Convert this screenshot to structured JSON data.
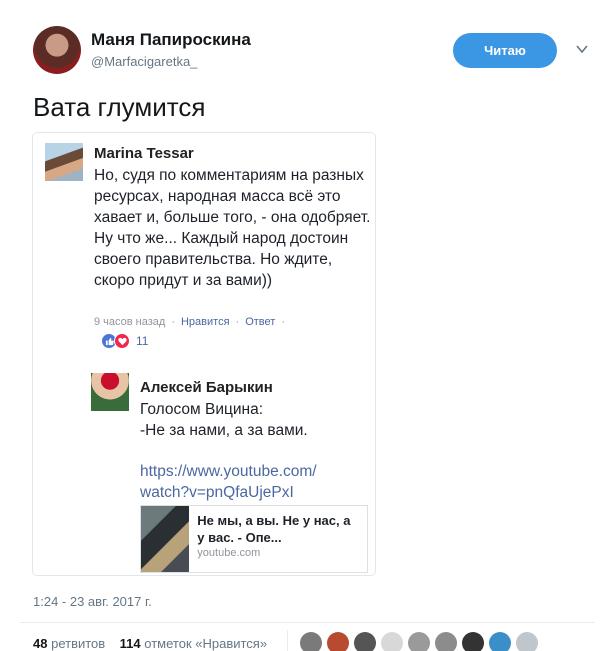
{
  "tweet": {
    "author_name": "Маня Папироскина",
    "author_handle": "@Marfacigaretka_",
    "follow_label": "Читаю",
    "text": "Вата глумится",
    "timestamp": "1:24 - 23 авг. 2017 г."
  },
  "card": {
    "comment1": {
      "author": "Marina Tessar",
      "text": "Но, судя по комментариям на разных ресурсах, народная масса всё это хавает и, больше того, - она одобряет. Ну что же... Каждый народ достоин своего правительства. Но ждите, скоро придут и за вами))",
      "time": "9 часов назад",
      "like_label": "Нравится",
      "reply_label": "Ответ",
      "reaction_count": "11"
    },
    "comment2": {
      "author": "Алексей Барыкин",
      "text_line1": "Голосом Вицина:",
      "text_line2": "-Не за нами, а за вами.",
      "link": "https://www.youtube.com/watch?v=pnQfaUjePxI",
      "preview_title": "Не мы, а вы. Не у нас, а у вас. - Опе...",
      "preview_domain": "youtube.com"
    }
  },
  "stats": {
    "retweets_count": "48",
    "retweets_label": "ретвитов",
    "likes_count": "114",
    "likes_label": "отметок «Нравится»"
  },
  "likers": [
    "#7a7a7a",
    "#b84a2f",
    "#555555",
    "#d8d8d8",
    "#9a9a9a",
    "#8c8c8c",
    "#333333",
    "#3b8fc9",
    "#bfc6cc"
  ],
  "colors": {
    "accent": "#3b97e3",
    "fb_link": "#4b67a1"
  }
}
